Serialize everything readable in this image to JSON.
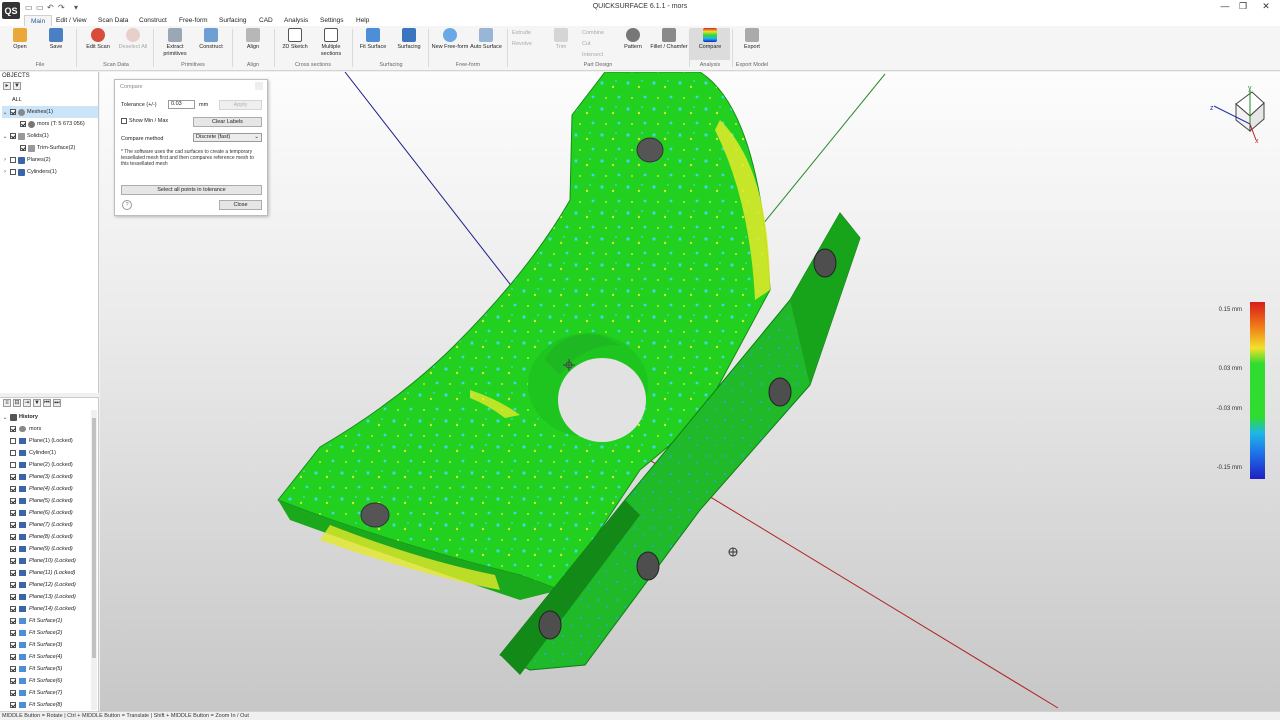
{
  "window": {
    "title": "QUICKSURFACE 6.1.1 - mors",
    "logo_text": "QS",
    "controls": {
      "minimize": "—",
      "maximize": "❐",
      "close": "✕"
    }
  },
  "menu": {
    "tabs": [
      "Main",
      "Edit / View",
      "Scan Data",
      "Construct",
      "Free-form",
      "Surfacing",
      "CAD",
      "Analysis",
      "Settings",
      "Help"
    ],
    "active": "Main"
  },
  "ribbon": {
    "buttons": [
      {
        "label": "Open",
        "icon": "folder-icon"
      },
      {
        "label": "Save",
        "icon": "save-icon"
      },
      {
        "label": "Edit Scan",
        "icon": "edit-scan-icon"
      },
      {
        "label": "Deselect All",
        "icon": "deselect-icon"
      },
      {
        "label": "Extract primitives",
        "icon": "extract-icon"
      },
      {
        "label": "Construct",
        "icon": "construct-icon"
      },
      {
        "label": "Align",
        "icon": "align-icon"
      },
      {
        "label": "2D Sketch",
        "icon": "sketch-icon"
      },
      {
        "label": "Multiple sections",
        "icon": "sections-icon"
      },
      {
        "label": "Fit Surface",
        "icon": "fit-surface-icon"
      },
      {
        "label": "Surfacing",
        "icon": "surfacing-icon"
      },
      {
        "label": "New Free-form",
        "icon": "freeform-icon"
      },
      {
        "label": "Auto Surface",
        "icon": "auto-surface-icon"
      },
      {
        "label": "Trim",
        "icon": "trim-icon"
      },
      {
        "label": "Pattern",
        "icon": "pattern-icon"
      },
      {
        "label": "Fillet / Chamfer",
        "icon": "fillet-icon"
      },
      {
        "label": "Compare",
        "icon": "compare-icon"
      },
      {
        "label": "Export",
        "icon": "export-icon"
      }
    ],
    "small_buttons": [
      "Extrude",
      "Revolve",
      "Combine",
      "Cut",
      "Intersect"
    ],
    "groups": [
      "File",
      "Scan Data",
      "Primitives",
      "Align",
      "Cross sections",
      "Surfacing",
      "Free-form",
      "Part Design",
      "Analysis",
      "Export Model"
    ]
  },
  "objects": {
    "header": "OBJECTS",
    "items": [
      {
        "label": "ALL"
      },
      {
        "label": "Meshes(1)"
      },
      {
        "label": "mors (T: 5 673 056)"
      },
      {
        "label": "Solids(1)"
      },
      {
        "label": "Trim-Surface(2)"
      },
      {
        "label": "Planes(2)"
      },
      {
        "label": "Cylinders(1)"
      }
    ]
  },
  "history": {
    "header": "History",
    "items": [
      "mors",
      "Plane(1) (Locked)",
      "Cylinder(1)",
      "Plane(2) (Locked)",
      "Plane(3) (Locked)",
      "Plane(4) (Locked)",
      "Plane(5) (Locked)",
      "Plane(6) (Locked)",
      "Plane(7) (Locked)",
      "Plane(8) (Locked)",
      "Plane(9) (Locked)",
      "Plane(10) (Locked)",
      "Plane(11) (Locked)",
      "Plane(12) (Locked)",
      "Plane(13) (Locked)",
      "Plane(14) (Locked)",
      "Fit Surface(1)",
      "Fit Surface(2)",
      "Fit Surface(3)",
      "Fit Surface(4)",
      "Fit Surface(5)",
      "Fit Surface(6)",
      "Fit Surface(7)",
      "Fit Surface(8)"
    ]
  },
  "compare_dialog": {
    "title": "Compare",
    "tolerance_label": "Tolerance (+/-)",
    "tolerance_value": "0.03",
    "unit": "mm",
    "apply": "Apply",
    "show_min_max": "Show Min / Max",
    "clear_labels": "Clear Labels",
    "compare_method_label": "Compare method",
    "compare_method_value": "Discrete (fast)",
    "note": "* The software uses the cad surfaces to create a temporary tessellated mesh first and then compares reference mesh to this tessellated mesh",
    "select_all": "Select all points in tolerance",
    "help": "?",
    "close": "Close"
  },
  "color_scale": {
    "labels": [
      "0.15 mm",
      "0.03 mm",
      "-0.03 mm",
      "-0.15 mm"
    ],
    "colors": [
      "#d81c1c",
      "#f07c17",
      "#f3e02a",
      "#2fdc2f",
      "#1fb7e6",
      "#1f6fe8",
      "#1f1fc2"
    ]
  },
  "axes": {
    "x": "x",
    "y": "y",
    "z": "z"
  },
  "statusbar": "MIDDLE Button = Rotate | Ctrl + MIDDLE Button = Translate | Shift + MIDDLE Button = Zoom In / Out"
}
